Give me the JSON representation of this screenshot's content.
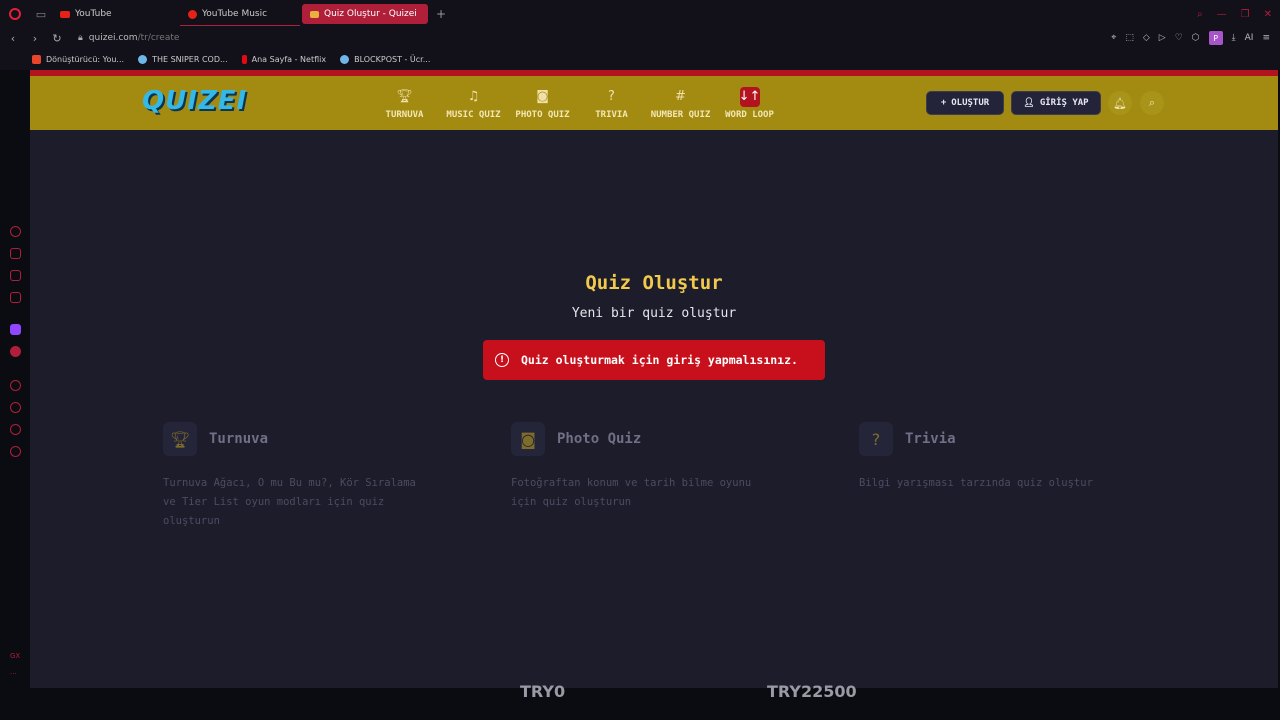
{
  "browser": {
    "tabs": [
      {
        "label": "YouTube",
        "icon": "youtube-icon"
      },
      {
        "label": "YouTube Music",
        "icon": "youtube-music-icon"
      },
      {
        "label": "Quiz Oluştur - Quizei",
        "icon": "quizei-favicon",
        "active": true
      }
    ],
    "new_tab": "+",
    "address": {
      "domain": "quizei.com",
      "path": "/tr/create"
    },
    "ai_label": "AI",
    "profile_initial": "P",
    "bookmarks": [
      {
        "label": "Dönüştürücü: You...",
        "color": "#e8452c"
      },
      {
        "label": "THE SNIPER COD...",
        "color": "#6fb6e8"
      },
      {
        "label": "Ana Sayfa - Netflix",
        "color": "#e50914"
      },
      {
        "label": "BLOCKPOST - Ücr...",
        "color": "#6fb6e8"
      }
    ],
    "sidebar_labels": {
      "gx": "GX",
      "more": "···"
    }
  },
  "site": {
    "logo": "QUIZEI",
    "nav": [
      {
        "label": "TURNUVA",
        "icon": "trophy-icon"
      },
      {
        "label": "MUSIC QUIZ",
        "icon": "music-note-icon"
      },
      {
        "label": "PHOTO QUIZ",
        "icon": "camera-icon"
      },
      {
        "label": "TRIVIA",
        "icon": "question-icon"
      },
      {
        "label": "NUMBER QUIZ",
        "icon": "hash-icon"
      },
      {
        "label": "WORD LOOP",
        "icon": "sort-icon",
        "highlighted": true
      }
    ],
    "create_button": "OLUŞTUR",
    "login_button": "GİRİŞ YAP",
    "page_title": "Quiz Oluştur",
    "page_subtitle": "Yeni bir quiz oluştur",
    "alert": "Quiz oluşturmak için giriş yapmalısınız.",
    "cards": [
      {
        "title": "Turnuva",
        "icon": "trophy-icon",
        "description": "Turnuva Ağacı, O mu Bu mu?, Kör Sıralama ve Tier List oyun modları için quiz oluşturun"
      },
      {
        "title": "Photo Quiz",
        "icon": "camera-icon",
        "description": "Fotoğraftan konum ve tarih bilme oyunu için quiz oluşturun"
      },
      {
        "title": "Trivia",
        "icon": "question-icon",
        "description": "Bilgi yarışması tarzında quiz oluştur"
      }
    ]
  },
  "overlay_bottom": {
    "left": "TRY0",
    "right": "TRY22500"
  },
  "colors": {
    "accent_red": "#b3121f",
    "header_gold": "#a38b12",
    "title_yellow": "#f2c94c",
    "bg_dark": "#1c1c2b"
  }
}
